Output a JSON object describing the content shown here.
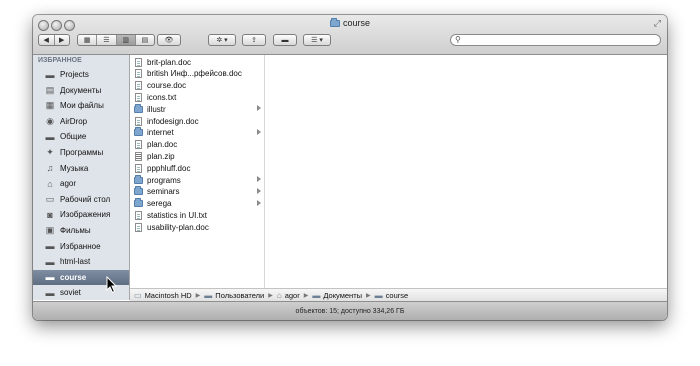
{
  "window": {
    "title": "course"
  },
  "toolbar": {
    "nav": [
      "◀",
      "▶"
    ],
    "views": [
      "▦",
      "☰",
      "▥",
      "▤"
    ],
    "eye_icon": "👁",
    "action_icon": "✲ ▾",
    "share_icon": "⇪",
    "toggle_icon": "▬",
    "arrange_icon": "☰ ▾",
    "search": {
      "placeholder": "",
      "icon": "🔍"
    }
  },
  "sidebar": {
    "header": "ИЗБРАННОЕ",
    "items": [
      {
        "label": "Projects",
        "icon": "folder-icon"
      },
      {
        "label": "Документы",
        "icon": "documents-icon"
      },
      {
        "label": "Мои файлы",
        "icon": "files-icon"
      },
      {
        "label": "AirDrop",
        "icon": "airdrop-icon"
      },
      {
        "label": "Общие",
        "icon": "folder-icon"
      },
      {
        "label": "Программы",
        "icon": "apps-icon"
      },
      {
        "label": "Музыка",
        "icon": "music-icon"
      },
      {
        "label": "agor",
        "icon": "home-icon"
      },
      {
        "label": "Рабочий стол",
        "icon": "desktop-icon"
      },
      {
        "label": "Изображения",
        "icon": "camera-icon"
      },
      {
        "label": "Фильмы",
        "icon": "film-icon"
      },
      {
        "label": "Избранное",
        "icon": "folder-icon"
      },
      {
        "label": "html-last",
        "icon": "folder-icon"
      },
      {
        "label": "course",
        "icon": "folder-icon",
        "selected": true
      },
      {
        "label": "soviet",
        "icon": "folder-icon"
      }
    ]
  },
  "files": [
    {
      "name": "brit-plan.doc",
      "type": "doc"
    },
    {
      "name": "british Инф...рфейсов.doc",
      "type": "doc"
    },
    {
      "name": "course.doc",
      "type": "doc"
    },
    {
      "name": "icons.txt",
      "type": "doc"
    },
    {
      "name": "illustr",
      "type": "folder"
    },
    {
      "name": "infodesign.doc",
      "type": "doc"
    },
    {
      "name": "internet",
      "type": "folder"
    },
    {
      "name": "plan.doc",
      "type": "doc"
    },
    {
      "name": "plan.zip",
      "type": "zip"
    },
    {
      "name": "ppphluff.doc",
      "type": "doc"
    },
    {
      "name": "programs",
      "type": "folder"
    },
    {
      "name": "seminars",
      "type": "folder"
    },
    {
      "name": "serega",
      "type": "folder"
    },
    {
      "name": "statistics in UI.txt",
      "type": "doc"
    },
    {
      "name": "usability-plan.doc",
      "type": "doc"
    }
  ],
  "pathbar": [
    "Macintosh HD",
    "Пользователи",
    "agor",
    "Документы",
    "course"
  ],
  "status": "объектов: 15; доступно 334,26 ГБ",
  "colors": {
    "selection": "#6b7a8f",
    "sidebar_bg": "#dfe4ea",
    "folder": "#7fa6cf"
  }
}
